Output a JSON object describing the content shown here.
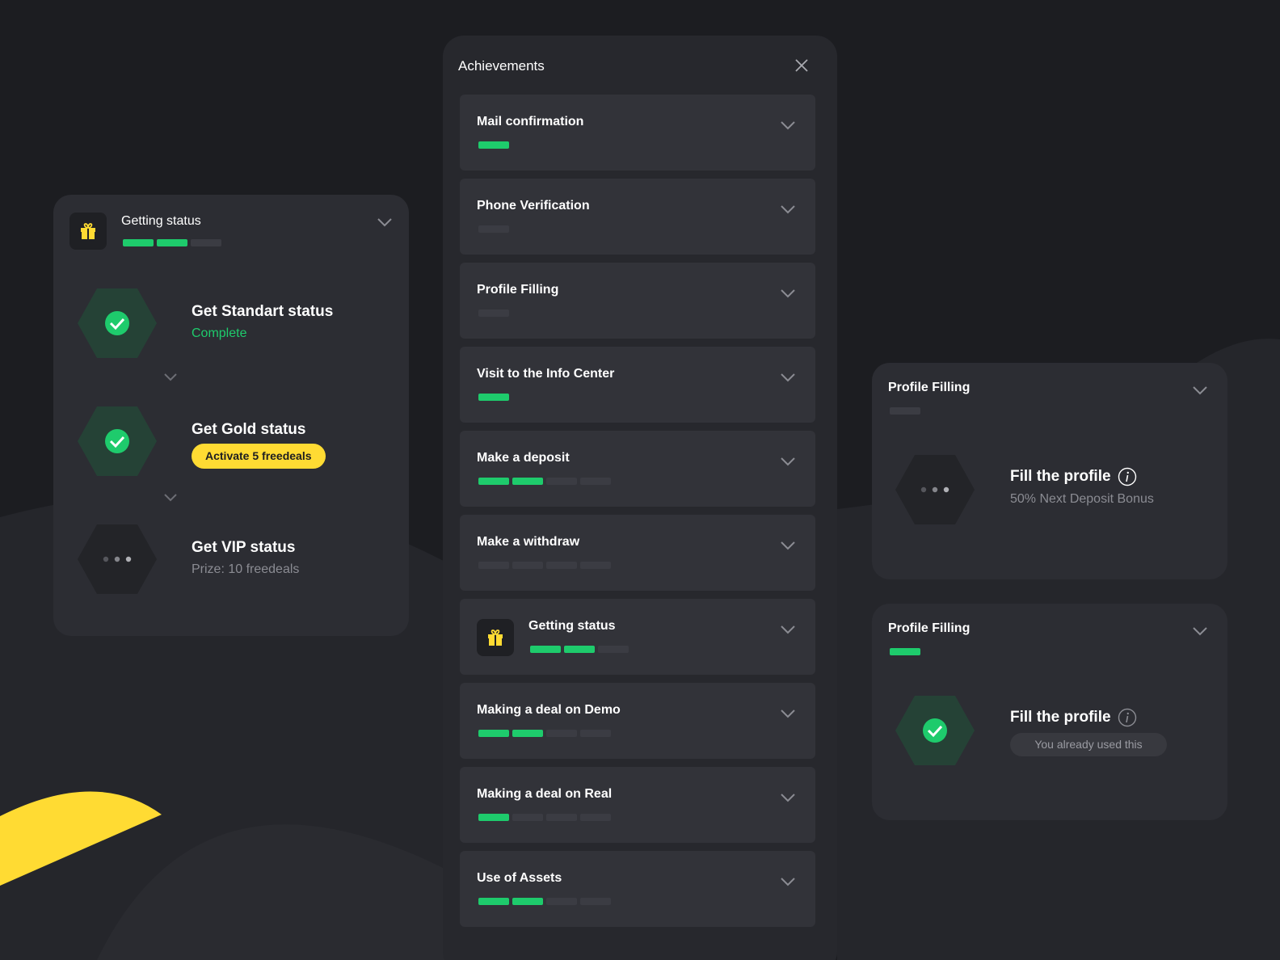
{
  "colors": {
    "background": "#1c1d21",
    "card": "#2c2d33",
    "accent_green": "#1ecb6c",
    "accent_yellow": "#ffdb33",
    "segment_off": "#3b3c43"
  },
  "left_card": {
    "title": "Getting status",
    "icon": "gift-icon",
    "progress": {
      "done": 2,
      "total": 3
    },
    "steps": [
      {
        "title": "Get Standart status",
        "subtitle": "Complete",
        "state": "done"
      },
      {
        "title": "Get Gold status",
        "badge": "Activate 5 freedeals",
        "state": "done"
      },
      {
        "title": "Get VIP status",
        "subtitle": "Prize: 10 freedeals",
        "state": "pending"
      }
    ]
  },
  "achievements": {
    "title": "Achievements",
    "close_icon": "close-icon",
    "items": [
      {
        "name": "Mail confirmation",
        "done": 1,
        "total": 1
      },
      {
        "name": "Phone Verification",
        "done": 0,
        "total": 1
      },
      {
        "name": "Profile Filling",
        "done": 0,
        "total": 1
      },
      {
        "name": "Visit to the Info Center",
        "done": 1,
        "total": 1
      },
      {
        "name": "Make a deposit",
        "done": 2,
        "total": 4
      },
      {
        "name": "Make a withdraw",
        "done": 0,
        "total": 4
      },
      {
        "name": "Getting status",
        "done": 2,
        "total": 3,
        "icon": "gift-icon"
      },
      {
        "name": "Making a deal on Demo",
        "done": 2,
        "total": 4
      },
      {
        "name": "Making a deal on Real",
        "done": 1,
        "total": 4
      },
      {
        "name": "Use of Assets",
        "done": 2,
        "total": 4
      }
    ]
  },
  "right_cards": [
    {
      "title": "Profile Filling",
      "progress": {
        "done": 0,
        "total": 1
      },
      "step_title": "Fill the profile",
      "step_subtitle": "50% Next Deposit Bonus",
      "state": "pending"
    },
    {
      "title": "Profile Filling",
      "progress": {
        "done": 1,
        "total": 1
      },
      "step_title": "Fill the profile",
      "step_badge": "You already used this",
      "state": "done"
    }
  ]
}
